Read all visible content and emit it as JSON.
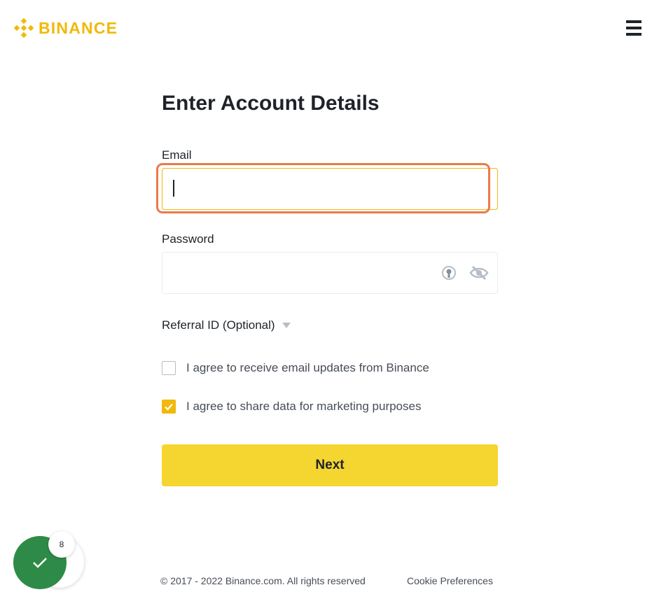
{
  "header": {
    "brand": "BINANCE",
    "logo_icon": "binance-diamond-icon",
    "menu_icon": "hamburger-menu-icon"
  },
  "form": {
    "title": "Enter Account Details",
    "email_label": "Email",
    "email_value": "",
    "email_placeholder": "",
    "password_label": "Password",
    "password_value": "",
    "password_icons": [
      "key-autofill-icon",
      "eye-slash-icon"
    ],
    "referral_label": "Referral ID (Optional)",
    "checkboxes": [
      {
        "label": "I agree to receive email updates from Binance",
        "checked": false
      },
      {
        "label": "I agree to share data for marketing purposes",
        "checked": true
      }
    ],
    "next_label": "Next"
  },
  "footer": {
    "copyright": "© 2017 - 2022 Binance.com. All rights reserved",
    "cookie_label": "Cookie Preferences"
  },
  "widget": {
    "badge_count": "8",
    "icon": "checkmark-icon"
  },
  "colors": {
    "brand": "#f0b90b",
    "button": "#f5d530",
    "focus_ring": "#ea7a4a",
    "widget": "#2e8b47"
  }
}
